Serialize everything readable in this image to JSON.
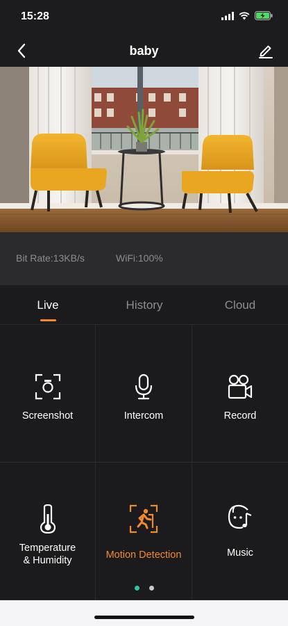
{
  "status_bar": {
    "time": "15:28",
    "icons": [
      "cellular-signal-icon",
      "wifi-icon",
      "battery-charging-icon"
    ]
  },
  "nav": {
    "title": "baby",
    "back_icon": "chevron-left-icon",
    "edit_icon": "pencil-icon"
  },
  "video": {
    "description_icon": "camera-live-feed"
  },
  "info": {
    "bitrate": "Bit Rate:13KB/s",
    "wifi": "WiFi:100%"
  },
  "tabs": [
    {
      "label": "Live",
      "active": true
    },
    {
      "label": "History",
      "active": false
    },
    {
      "label": "Cloud",
      "active": false
    }
  ],
  "actions": [
    {
      "label": "Screenshot",
      "icon": "screenshot-icon"
    },
    {
      "label": "Intercom",
      "icon": "microphone-icon"
    },
    {
      "label": "Record",
      "icon": "video-camera-icon"
    },
    {
      "label": "Temperature\n& Humidity",
      "icon": "thermometer-icon"
    },
    {
      "label": "Motion Detection",
      "icon": "motion-detection-icon",
      "active": true
    },
    {
      "label": "Music",
      "icon": "music-icon"
    }
  ],
  "pager": {
    "pages": 2,
    "current": 1
  },
  "colors": {
    "accent": "#f18a2e",
    "pager_active": "#2fc4a5",
    "background": "#1b1b1d",
    "battery": "#4cd964"
  }
}
